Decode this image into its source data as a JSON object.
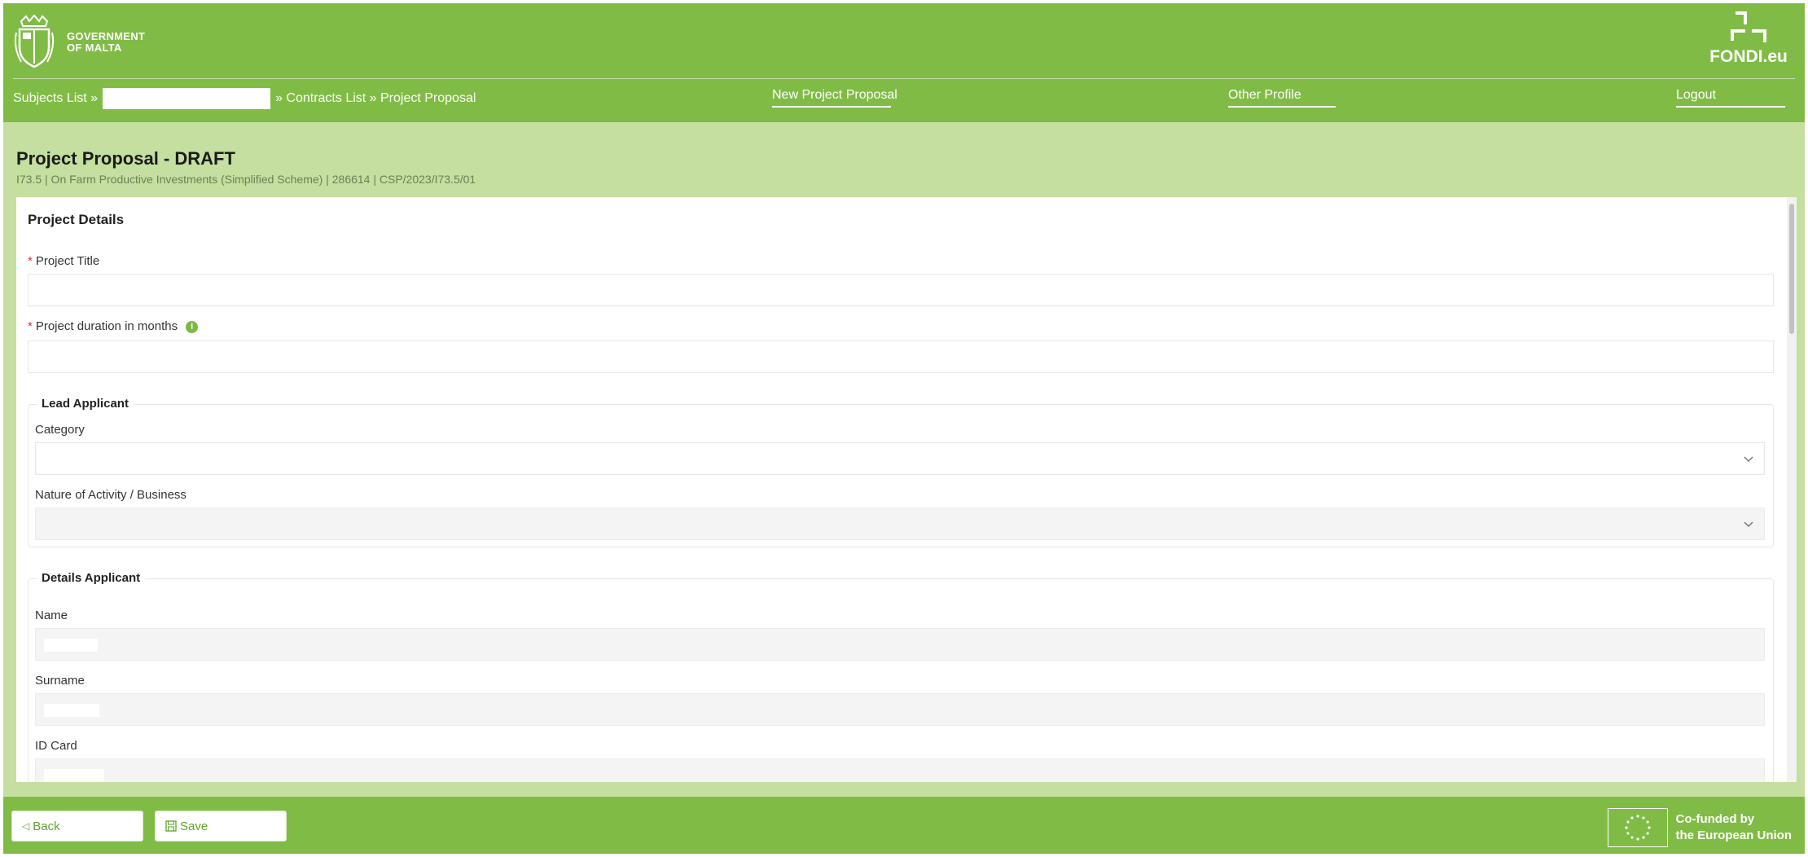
{
  "header": {
    "org_line1": "GOVERNMENT",
    "org_line2": "OF MALTA",
    "brand": "FONDI.eu"
  },
  "breadcrumb": {
    "subjects": "Subjects List »",
    "contracts": "» Contracts List » Project Proposal"
  },
  "nav": {
    "new_proposal": "New Project Proposal",
    "other_profile": "Other Profile",
    "logout": "Logout"
  },
  "page": {
    "title": "Project Proposal - DRAFT",
    "subtitle": "I73.5 | On Farm Productive Investments (Simplified Scheme) | 286614 | CSP/2023/I73.5/01"
  },
  "form": {
    "section_title": "Project Details",
    "project_title": {
      "label": "Project Title",
      "value": ""
    },
    "duration": {
      "label": "Project duration in months",
      "value": "",
      "info_icon": "info-icon"
    },
    "lead_applicant": {
      "legend": "Lead Applicant",
      "category": {
        "label": "Category",
        "value": ""
      },
      "nature": {
        "label": "Nature of Activity / Business",
        "value": ""
      }
    },
    "details_applicant": {
      "legend": "Details Applicant",
      "name": {
        "label": "Name"
      },
      "surname": {
        "label": "Surname"
      },
      "id_card": {
        "label": "ID Card"
      }
    }
  },
  "footer": {
    "back_label": "Back",
    "save_label": "Save",
    "eu_line1": "Co-funded by",
    "eu_line2": "the European Union"
  },
  "colors": {
    "brand_green": "#80bc45",
    "light_green": "#c4df9f",
    "required": "#e0312b"
  }
}
